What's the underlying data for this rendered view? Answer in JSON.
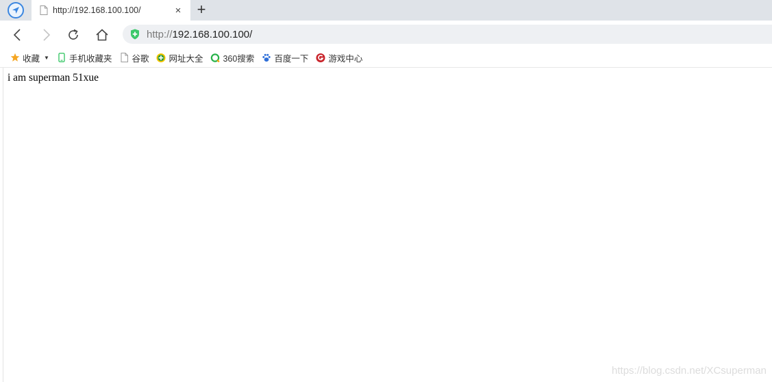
{
  "tab": {
    "title": "http://192.168.100.100/",
    "close_label": "×",
    "new_tab_label": "+"
  },
  "address_bar": {
    "scheme": "http://",
    "host": "192.168.100.100/"
  },
  "bookmarks": [
    {
      "label": "收藏",
      "icon": "star-icon"
    },
    {
      "label": "手机收藏夹",
      "icon": "phone-icon"
    },
    {
      "label": "谷歌",
      "icon": "page-icon"
    },
    {
      "label": "网址大全",
      "icon": "site-nav-icon"
    },
    {
      "label": "360搜索",
      "icon": "360-search-icon"
    },
    {
      "label": "百度一下",
      "icon": "baidu-paw-icon"
    },
    {
      "label": "游戏中心",
      "icon": "game-center-icon"
    }
  ],
  "page": {
    "body_text": "i am superman 51xue"
  },
  "watermark": "https://blog.csdn.net/XCsuperman",
  "colors": {
    "tabstrip_bg": "#dfe3e8",
    "address_bg": "#eef0f3",
    "shield_green": "#3cc86a",
    "browser_blue": "#3a86e0"
  }
}
